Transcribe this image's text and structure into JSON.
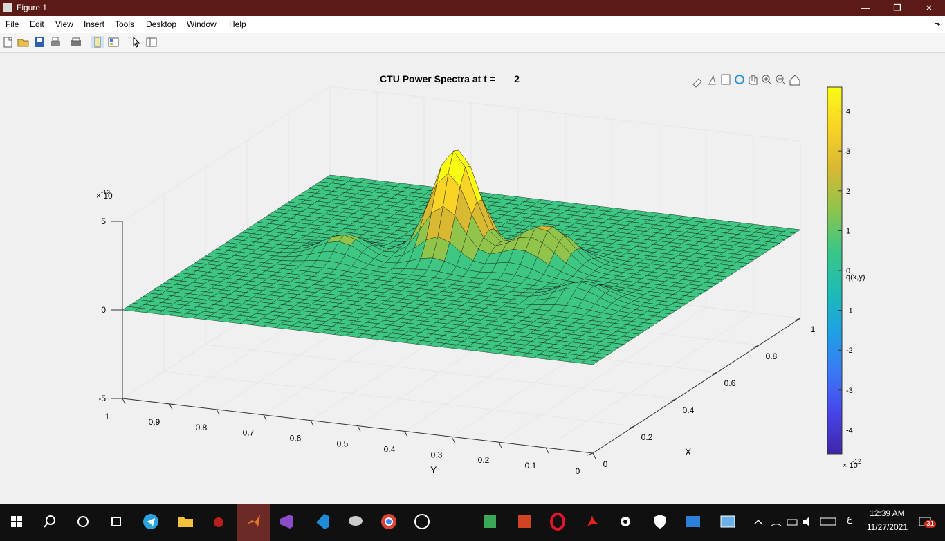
{
  "window": {
    "title": "Figure 1",
    "minimize": "—",
    "restore": "❐",
    "close": "✕"
  },
  "menu": [
    "File",
    "Edit",
    "View",
    "Insert",
    "Tools",
    "Desktop",
    "Window",
    "Help"
  ],
  "menu_dock": "⬎",
  "toolbar_icons": [
    "new-figure-icon",
    "open-file-icon",
    "save-icon",
    "print-icon",
    "print-preview-icon",
    "property-editor-icon",
    "colorbar-icon",
    "select-pointer-icon",
    "plot-browser-icon"
  ],
  "axes_toolbar_icons": [
    "brush-icon",
    "data-tips-icon",
    "export-icon",
    "rotate-3d-icon",
    "pan-icon",
    "zoom-in-icon",
    "zoom-out-icon",
    "home-icon"
  ],
  "chart_data": {
    "type": "surface",
    "title": "CTU Power Spectra at t =       2",
    "xlabel": "X",
    "ylabel": "Y",
    "zlabel": "",
    "x_ticks": [
      "0",
      "0.2",
      "0.4",
      "0.6",
      "0.8",
      "1"
    ],
    "y_ticks": [
      "1",
      "0.9",
      "0.8",
      "0.7",
      "0.6",
      "0.5",
      "0.4",
      "0.3",
      "0.2",
      "0.1",
      "0"
    ],
    "z_ticks": [
      "5",
      "0",
      "-5"
    ],
    "z_exponent_base": "× 10",
    "z_exponent": "-12",
    "zlim": [
      -5,
      5
    ],
    "colorbar": {
      "label": "q(x,y)",
      "ticks": [
        "4",
        "3",
        "2",
        "1",
        "0",
        "-1",
        "-2",
        "-3",
        "-4"
      ],
      "exponent_base": "× 10",
      "exponent": "-12",
      "range": [
        -4.6,
        4.6
      ],
      "colormap": "parula",
      "colors": [
        "#3e26a8",
        "#4744e8",
        "#3a78f6",
        "#1fa0e4",
        "#1cbcb6",
        "#3ec783",
        "#91c44b",
        "#d9b832",
        "#f9d326",
        "#f9fb15"
      ]
    },
    "peaks_description_values": [
      {
        "x": 0.5,
        "y": 0.75,
        "z": 1.2
      },
      {
        "x": 0.55,
        "y": 0.55,
        "z": 2.5
      },
      {
        "x": 0.6,
        "y": 0.55,
        "z": 4.5
      },
      {
        "x": 0.6,
        "y": 0.35,
        "z": 1.8
      },
      {
        "x": 0.55,
        "y": 0.4,
        "z": 1.2
      },
      {
        "x": 0.4,
        "y": 0.2,
        "z": 1.0
      }
    ]
  },
  "taskbar": {
    "clock_time": "12:39 AM",
    "clock_date": "11/27/2021",
    "notification_count": "31",
    "lang": "ع"
  }
}
